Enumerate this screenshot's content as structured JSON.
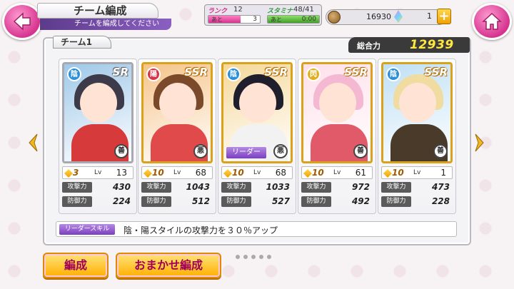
{
  "header": {
    "title": "チーム編成",
    "subtitle": "チームを編成してください",
    "rank_label": "ランク",
    "rank_value": "12",
    "rank_next_label": "あと",
    "rank_next_value": "3",
    "rank_progress": 0.62,
    "stamina_label": "スタミナ",
    "stamina_value": "48/41",
    "stamina_next_label": "あと",
    "stamina_next_value": "0:00",
    "stamina_progress": 1.0,
    "coins": "16930",
    "gems": "1",
    "plus_label": "+"
  },
  "team": {
    "name": "チーム1",
    "total_label": "総合力",
    "total_value": "12939"
  },
  "cards": [
    {
      "rarity": "SR",
      "attr": "陰",
      "attr_color": "#2a8fd6",
      "type": "善",
      "leader": "",
      "limit": "3",
      "lv_label": "Lv",
      "lv": "13",
      "atk_label": "攻撃力",
      "atk": "430",
      "def_label": "防御力",
      "def": "224",
      "hair": "#3d3b4a",
      "body": "#d63a3a",
      "bg": "#9fc8e8"
    },
    {
      "rarity": "SSR",
      "attr": "陽",
      "attr_color": "#d6344a",
      "type": "悪",
      "leader": "",
      "limit": "10",
      "lv_label": "Lv",
      "lv": "68",
      "atk_label": "攻撃力",
      "atk": "1043",
      "def_label": "防御力",
      "def": "512",
      "hair": "#7a4a2a",
      "body": "#e04a4a",
      "bg": "#f5c48a"
    },
    {
      "rarity": "SSR",
      "attr": "陰",
      "attr_color": "#2a8fd6",
      "type": "悪",
      "leader": "リーダー",
      "limit": "10",
      "lv_label": "Lv",
      "lv": "68",
      "atk_label": "攻撃力",
      "atk": "1033",
      "def_label": "防御力",
      "def": "527",
      "hair": "#1e1e2c",
      "body": "#f2f2f2",
      "bg": "#f5d89a"
    },
    {
      "rarity": "SSR",
      "attr": "閃",
      "attr_color": "#e0b020",
      "type": "善",
      "leader": "",
      "limit": "10",
      "lv_label": "Lv",
      "lv": "61",
      "atk_label": "攻撃力",
      "atk": "972",
      "def_label": "防御力",
      "def": "492",
      "hair": "#f5b8d2",
      "body": "#e05a6a",
      "bg": "#ffe0ea"
    },
    {
      "rarity": "SSR",
      "attr": "陰",
      "attr_color": "#2a8fd6",
      "type": "善",
      "leader": "",
      "limit": "10",
      "lv_label": "Lv",
      "lv": "1",
      "atk_label": "攻撃力",
      "atk": "473",
      "def_label": "防御力",
      "def": "228",
      "hair": "#f0dca0",
      "body": "#4a3a2a",
      "bg": "#bfe0f5"
    }
  ],
  "leader_skill": {
    "label": "リーダースキル",
    "text": "陰・陽スタイルの攻撃力を３０％アップ"
  },
  "buttons": {
    "formation": "編成",
    "auto_formation": "おまかせ編成"
  },
  "icons": {
    "back": "back-arrow-icon",
    "home": "home-icon",
    "prev": "chevron-left-icon",
    "next": "chevron-right-icon"
  }
}
